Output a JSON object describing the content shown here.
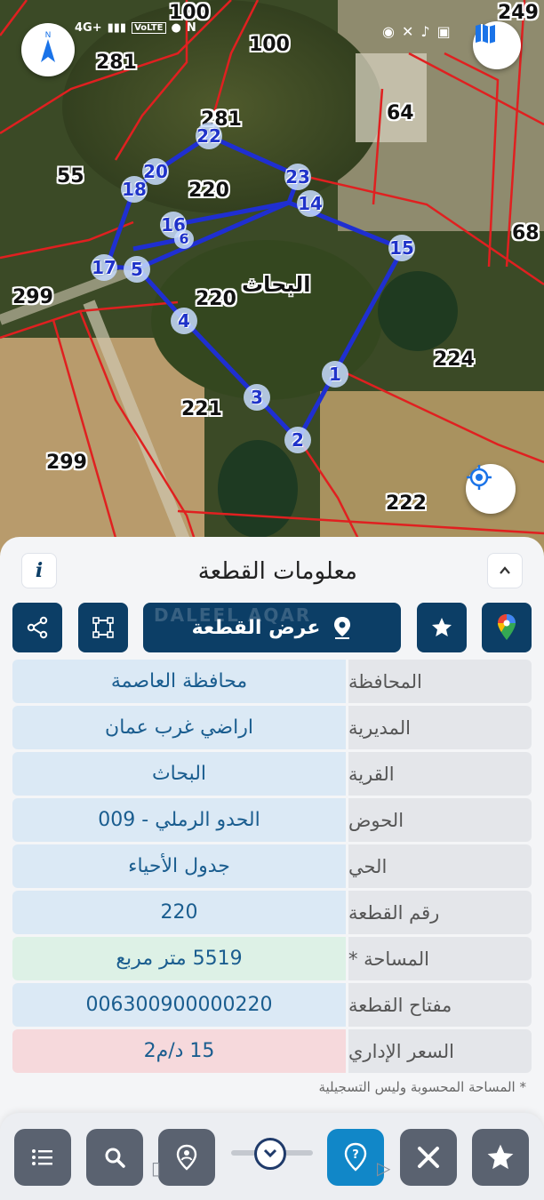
{
  "status_bar": {
    "network": "4G+",
    "volte": "VoLTE"
  },
  "map": {
    "parcel_numbers": [
      "249",
      "100",
      "100",
      "281",
      "281",
      "55",
      "220",
      "64",
      "68",
      "299",
      "220",
      "224",
      "221",
      "299",
      "222"
    ],
    "area_label": "البحاث",
    "vertices": [
      "22",
      "23",
      "14",
      "15",
      "1",
      "2",
      "3",
      "4",
      "5",
      "17",
      "18",
      "20",
      "16",
      "6"
    ]
  },
  "panel": {
    "title": "معلومات القطعة",
    "show_parcel_label": "عرض القطعة",
    "watermark": "DALEEL AQAR",
    "rows": [
      {
        "label": "المحافظة",
        "value": "محافظة العاصمة"
      },
      {
        "label": "المديرية",
        "value": "اراضي غرب عمان"
      },
      {
        "label": "القرية",
        "value": "البحاث"
      },
      {
        "label": "الحوض",
        "value": "الحدو الرملي - 009"
      },
      {
        "label": "الحي",
        "value": "جدول الأحياء"
      },
      {
        "label": "رقم القطعة",
        "value": "220"
      },
      {
        "label": "المساحة *",
        "value": "5519  متر مربع"
      },
      {
        "label": "مفتاح القطعة",
        "value": "006300900000220"
      },
      {
        "label": "السعر الإداري",
        "value": "15 د/م2"
      }
    ],
    "footnote": "* المساحة المحسوبة وليس التسجيلية"
  },
  "icons": {
    "compass": "compass-north-icon",
    "book": "map-book-icon",
    "locate": "my-location-icon",
    "info": "info-icon",
    "collapse": "chevron-up-icon",
    "share": "share-icon",
    "polygon": "polygon-icon",
    "pin": "location-pin-icon",
    "star": "star-icon",
    "gmaps": "google-maps-icon"
  },
  "colors": {
    "primary": "#0c3e66",
    "active_nav": "#1187c8",
    "parcel_outline": "#1f2fd1",
    "boundaries": "#e02020"
  }
}
